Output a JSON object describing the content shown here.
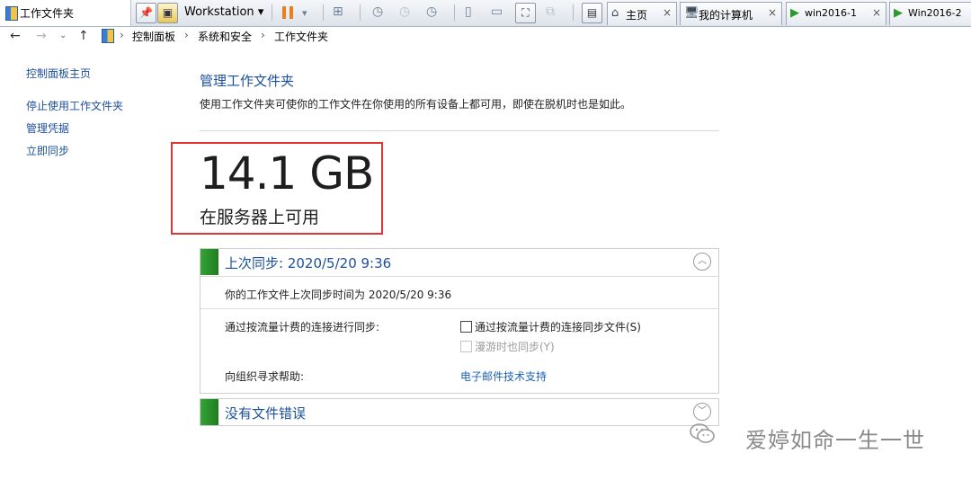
{
  "window": {
    "title": "工作文件夹"
  },
  "toolbar": {
    "workstation_label": "Workstation",
    "dropdown_glyph": "▾",
    "tabs": [
      {
        "label": "主页",
        "icon": "home-icon"
      },
      {
        "label": "我的计算机",
        "icon": "computer-icon"
      },
      {
        "label": "win2016-1",
        "icon": "vm-icon"
      },
      {
        "label": "Win2016-2",
        "icon": "vm-icon"
      }
    ],
    "close_glyph": "×"
  },
  "breadcrumb": {
    "items": [
      "控制面板",
      "系统和安全",
      "工作文件夹"
    ],
    "separator": "›"
  },
  "sidebar": {
    "home_link": "控制面板主页",
    "items": [
      "停止使用工作文件夹",
      "管理凭据",
      "立即同步"
    ]
  },
  "main": {
    "title": "管理工作文件夹",
    "description": "使用工作文件夹可使你的工作文件在你使用的所有设备上都可用，即使在脱机时也是如此。",
    "storage_size": "14.1 GB",
    "storage_caption": "在服务器上可用",
    "sync_panel": {
      "title": "上次同步: 2020/5/20 9:36",
      "last_sync_text": "你的工作文件上次同步时间为 2020/5/20 9:36",
      "metered_label": "通过按流量计费的连接进行同步:",
      "metered_option": "通过按流量计费的连接同步文件(S)",
      "metered_checked": false,
      "roaming_option": "漫游时也同步(Y)",
      "roaming_enabled": false,
      "help_label": "向组织寻求帮助:",
      "help_link": "电子邮件技术支持"
    },
    "error_panel": {
      "title": "没有文件错误"
    }
  },
  "watermark": {
    "text": "爱婷如命一生一世"
  },
  "colors": {
    "accent": "#1c4f9c",
    "highlight_box": "#e03333",
    "status_green": "#2a9a2a"
  }
}
